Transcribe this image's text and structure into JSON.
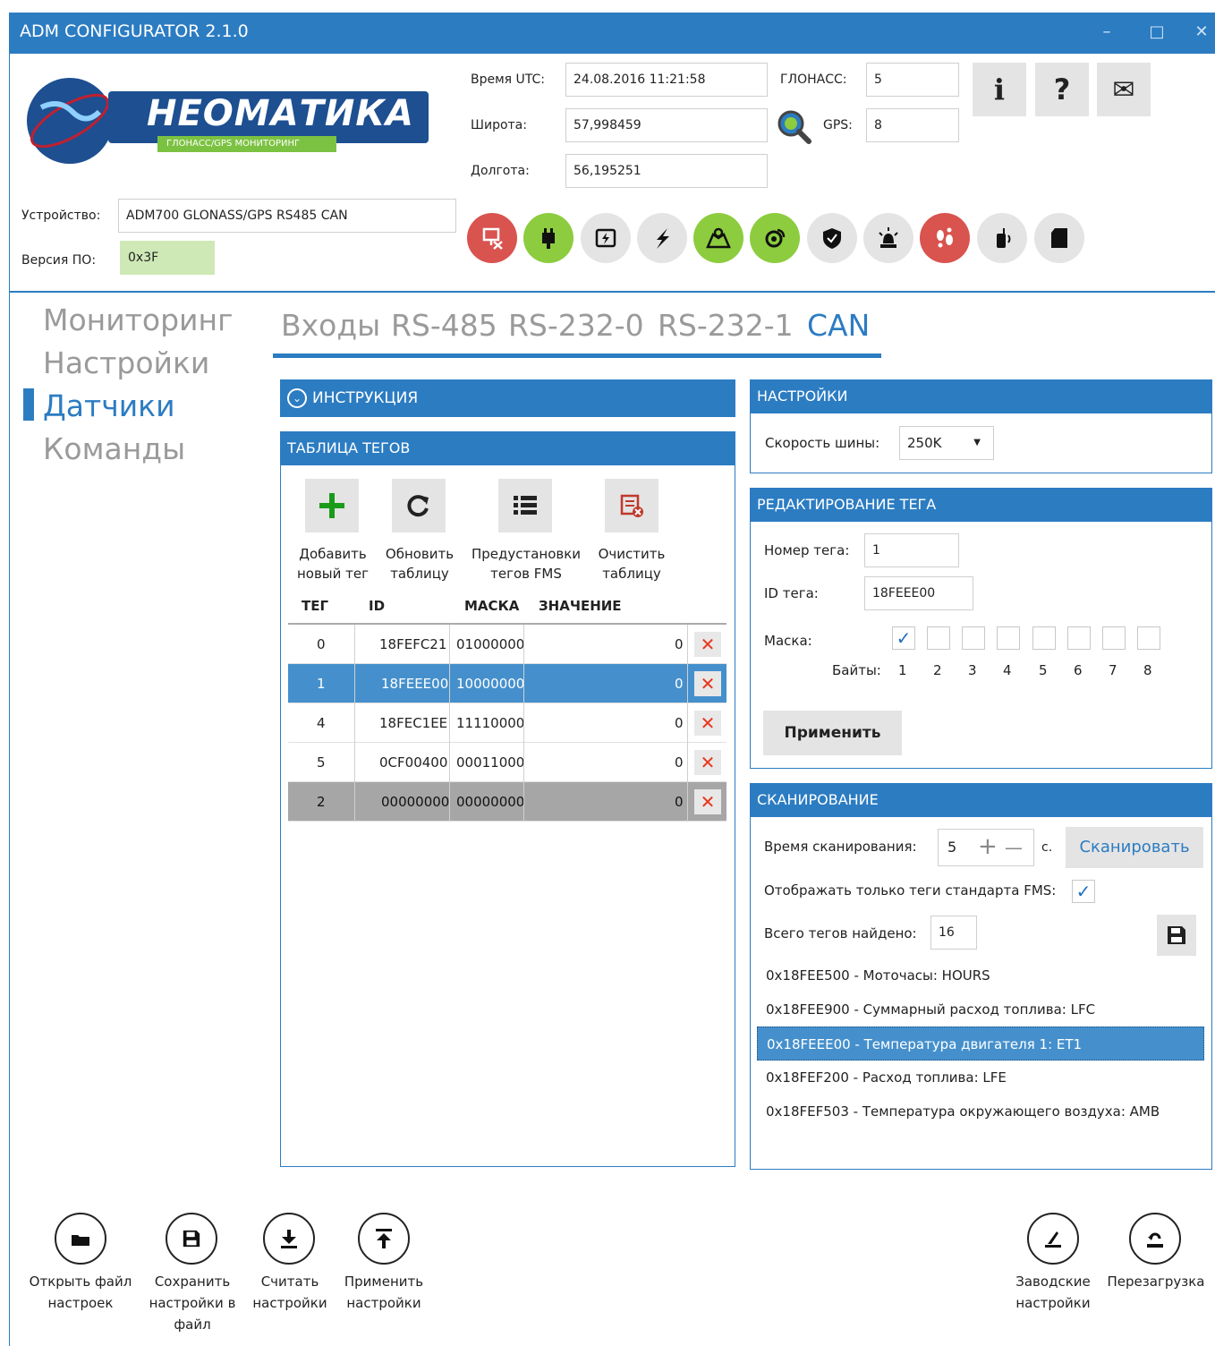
{
  "window": {
    "title": "ADM CONFIGURATOR 2.1.0",
    "minimize": "–",
    "maximize": "□",
    "close": "✕"
  },
  "logo": {
    "brand": "НЕОМАТИКА",
    "tagline": "ГЛОНАСС/GPS МОНИТОРИНГ"
  },
  "status": {
    "utc_label": "Время UTC:",
    "utc_value": "24.08.2016 11:21:58",
    "lat_label": "Широта:",
    "lat_value": "57,998459",
    "lon_label": "Долгота:",
    "lon_value": "56,195251",
    "glonass_label": "ГЛОНАСС:",
    "glonass_value": "5",
    "gps_label": "GPS:",
    "gps_value": "8"
  },
  "top_buttons": {
    "info": "i",
    "help": "?",
    "mail": "✉"
  },
  "device": {
    "device_label": "Устройство:",
    "device_value": "ADM700 GLONASS/GPS RS485 CAN",
    "fw_label": "Версия ПО:",
    "fw_value": "0x3F"
  },
  "status_icons": [
    {
      "name": "network-error-icon",
      "color": "#d9534f"
    },
    {
      "name": "power-plug-icon",
      "color": "#8ccc3e"
    },
    {
      "name": "battery-icon",
      "color": "#e4e4e4"
    },
    {
      "name": "lightning-icon",
      "color": "#e4e4e4"
    },
    {
      "name": "map-icon",
      "color": "#8ccc3e"
    },
    {
      "name": "satellite-icon",
      "color": "#8ccc3e"
    },
    {
      "name": "shield-icon",
      "color": "#e4e4e4"
    },
    {
      "name": "alarm-light-icon",
      "color": "#e4e4e4"
    },
    {
      "name": "footprints-icon",
      "color": "#d9534f"
    },
    {
      "name": "walkie-talkie-icon",
      "color": "#e4e4e4"
    },
    {
      "name": "sd-card-icon",
      "color": "#e4e4e4"
    }
  ],
  "nav": {
    "monitoring": "Мониторинг",
    "settings": "Настройки",
    "sensors": "Датчики",
    "commands": "Команды"
  },
  "tabs": {
    "inputs": "Входы",
    "rs485": "RS-485",
    "rs232_0": "RS-232-0",
    "rs232_1": "RS-232-1",
    "can": "CAN"
  },
  "instruction": {
    "title": "ИНСТРУКЦИЯ"
  },
  "tag_table": {
    "title": "ТАБЛИЦА ТЕГОВ",
    "add_line1": "Добавить",
    "add_line2": "новый тег",
    "refresh_line1": "Обновить",
    "refresh_line2": "таблицу",
    "presets_line1": "Предустановки",
    "presets_line2": "тегов FMS",
    "clear_line1": "Очистить",
    "clear_line2": "таблицу",
    "col_tag": "ТЕГ",
    "col_id": "ID",
    "col_mask": "МАСКА",
    "col_value": "ЗНАЧЕНИЕ",
    "delete": "✕",
    "rows": [
      {
        "tag": "0",
        "id": "18FEFC21",
        "mask": "01000000",
        "value": "0"
      },
      {
        "tag": "1",
        "id": "18FEEE00",
        "mask": "10000000",
        "value": "0"
      },
      {
        "tag": "4",
        "id": "18FEC1EE",
        "mask": "11110000",
        "value": "0"
      },
      {
        "tag": "5",
        "id": "0CF00400",
        "mask": "00011000",
        "value": "0"
      },
      {
        "tag": "2",
        "id": "00000000",
        "mask": "00000000",
        "value": "0"
      }
    ]
  },
  "settings": {
    "title": "НАСТРОЙКИ",
    "bus_speed_label": "Скорость шины:",
    "bus_speed_value": "250K"
  },
  "tag_edit": {
    "title": "РЕДАКТИРОВАНИЕ ТЕГА",
    "number_label": "Номер тега:",
    "number_value": "1",
    "id_label": "ID тега:",
    "id_value": "18FEEE00",
    "mask_label": "Маска:",
    "bytes_label": "Байты:",
    "bytes": [
      "1",
      "2",
      "3",
      "4",
      "5",
      "6",
      "7",
      "8"
    ],
    "checkmark": "✓",
    "apply": "Применить"
  },
  "scan": {
    "title": "СКАНИРОВАНИЕ",
    "time_label": "Время сканирования:",
    "time_value": "5",
    "plus": "+",
    "minus": "—",
    "unit": "с.",
    "scan_button": "Сканировать",
    "fms_only_label": "Отображать только теги стандарта FMS:",
    "found_label": "Всего тегов найдено:",
    "found_value": "16",
    "items": [
      "0x18FEE500 - Моточасы: HOURS",
      "0x18FEE900 - Суммарный расход топлива: LFC",
      "0x18FEEE00 - Температура двигателя 1: ET1",
      "0x18FEF200 - Расход топлива: LFE",
      "0x18FEF503 - Температура окружающего воздуха: AMB"
    ]
  },
  "bottom": {
    "open_line1": "Открыть файл",
    "open_line2": "настроек",
    "save_line1": "Сохранить",
    "save_line2": "настройки в",
    "save_line3": "файл",
    "read_line1": "Считать",
    "read_line2": "настройки",
    "applyset_line1": "Применить",
    "applyset_line2": "настройки",
    "factory_line1": "Заводские",
    "factory_line2": "настройки",
    "reboot": "Перезагрузка"
  }
}
